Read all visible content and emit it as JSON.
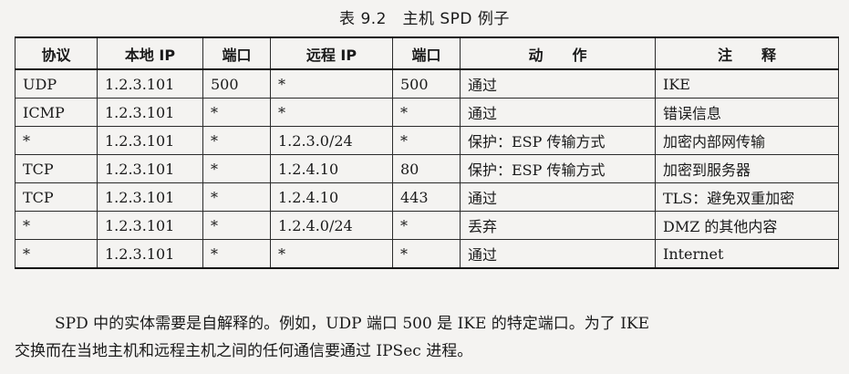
{
  "caption": "表 9.2　主机 SPD 例子",
  "table": {
    "headers": [
      "协议",
      "本地 IP",
      "端口",
      "远程 IP",
      "端口",
      "动　　作",
      "注　　释"
    ],
    "rows": [
      [
        "UDP",
        "1.2.3.101",
        "500",
        "*",
        "500",
        "通过",
        "IKE"
      ],
      [
        "ICMP",
        "1.2.3.101",
        "*",
        "*",
        "*",
        "通过",
        "错误信息"
      ],
      [
        "*",
        "1.2.3.101",
        "*",
        "1.2.3.0/24",
        "*",
        "保护：ESP 传输方式",
        "加密内部网传输"
      ],
      [
        "TCP",
        "1.2.3.101",
        "*",
        "1.2.4.10",
        "80",
        "保护：ESP 传输方式",
        "加密到服务器"
      ],
      [
        "TCP",
        "1.2.3.101",
        "*",
        "1.2.4.10",
        "443",
        "通过",
        "TLS：避免双重加密"
      ],
      [
        "*",
        "1.2.3.101",
        "*",
        "1.2.4.0/24",
        "*",
        "丢弃",
        "DMZ 的其他内容"
      ],
      [
        "*",
        "1.2.3.101",
        "*",
        "*",
        "*",
        "通过",
        "Internet"
      ]
    ]
  },
  "paragraph": {
    "line1": "SPD 中的实体需要是自解释的。例如，UDP 端口 500 是 IKE 的特定端口。为了 IKE",
    "line2": "交换而在当地主机和远程主机之间的任何通信要通过 IPSec 进程。"
  }
}
